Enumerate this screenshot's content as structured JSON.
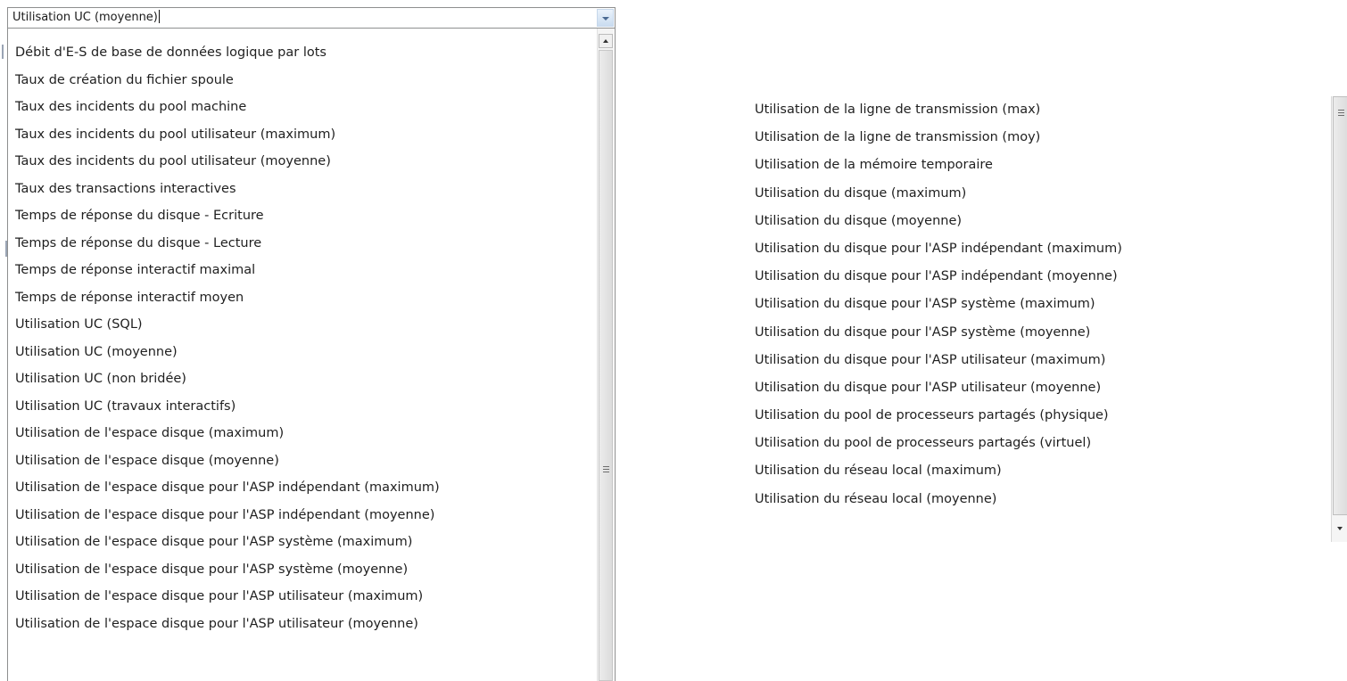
{
  "combo": {
    "value": "Utilisation UC (moyenne)"
  },
  "dropdown_items": [
    "Débit d'E-S de base de données logique par lots",
    "Taux de création du fichier spoule",
    "Taux des incidents du pool machine",
    "Taux des incidents du pool utilisateur (maximum)",
    "Taux des incidents du pool utilisateur (moyenne)",
    "Taux des transactions interactives",
    "Temps de réponse du disque - Ecriture",
    "Temps de réponse du disque - Lecture",
    "Temps de réponse interactif maximal",
    "Temps de réponse interactif moyen",
    "Utilisation UC (SQL)",
    "Utilisation UC (moyenne)",
    "Utilisation UC (non bridée)",
    "Utilisation UC (travaux interactifs)",
    "Utilisation de l'espace disque (maximum)",
    "Utilisation de l'espace disque (moyenne)",
    "Utilisation de l'espace disque pour l'ASP indépendant (maximum)",
    "Utilisation de l'espace disque pour l'ASP indépendant (moyenne)",
    "Utilisation de l'espace disque pour l'ASP système (maximum)",
    "Utilisation de l'espace disque pour l'ASP système (moyenne)",
    "Utilisation de l'espace disque pour l'ASP utilisateur (maximum)",
    "Utilisation de l'espace disque pour l'ASP utilisateur (moyenne)"
  ],
  "continued_items": [
    "Utilisation de la ligne de transmission (max)",
    "Utilisation de la ligne de transmission (moy)",
    "Utilisation de la mémoire temporaire",
    "Utilisation du disque (maximum)",
    "Utilisation du disque (moyenne)",
    "Utilisation du disque pour l'ASP indépendant (maximum)",
    "Utilisation du disque pour l'ASP indépendant (moyenne)",
    "Utilisation du disque pour l'ASP système (maximum)",
    "Utilisation du disque pour l'ASP système (moyenne)",
    "Utilisation du disque pour l'ASP utilisateur (maximum)",
    "Utilisation du disque pour l'ASP utilisateur (moyenne)",
    "Utilisation du pool de processeurs partagés (physique)",
    "Utilisation du pool de processeurs partagés (virtuel)",
    "Utilisation du réseau local (maximum)",
    "Utilisation du réseau local (moyenne)"
  ]
}
